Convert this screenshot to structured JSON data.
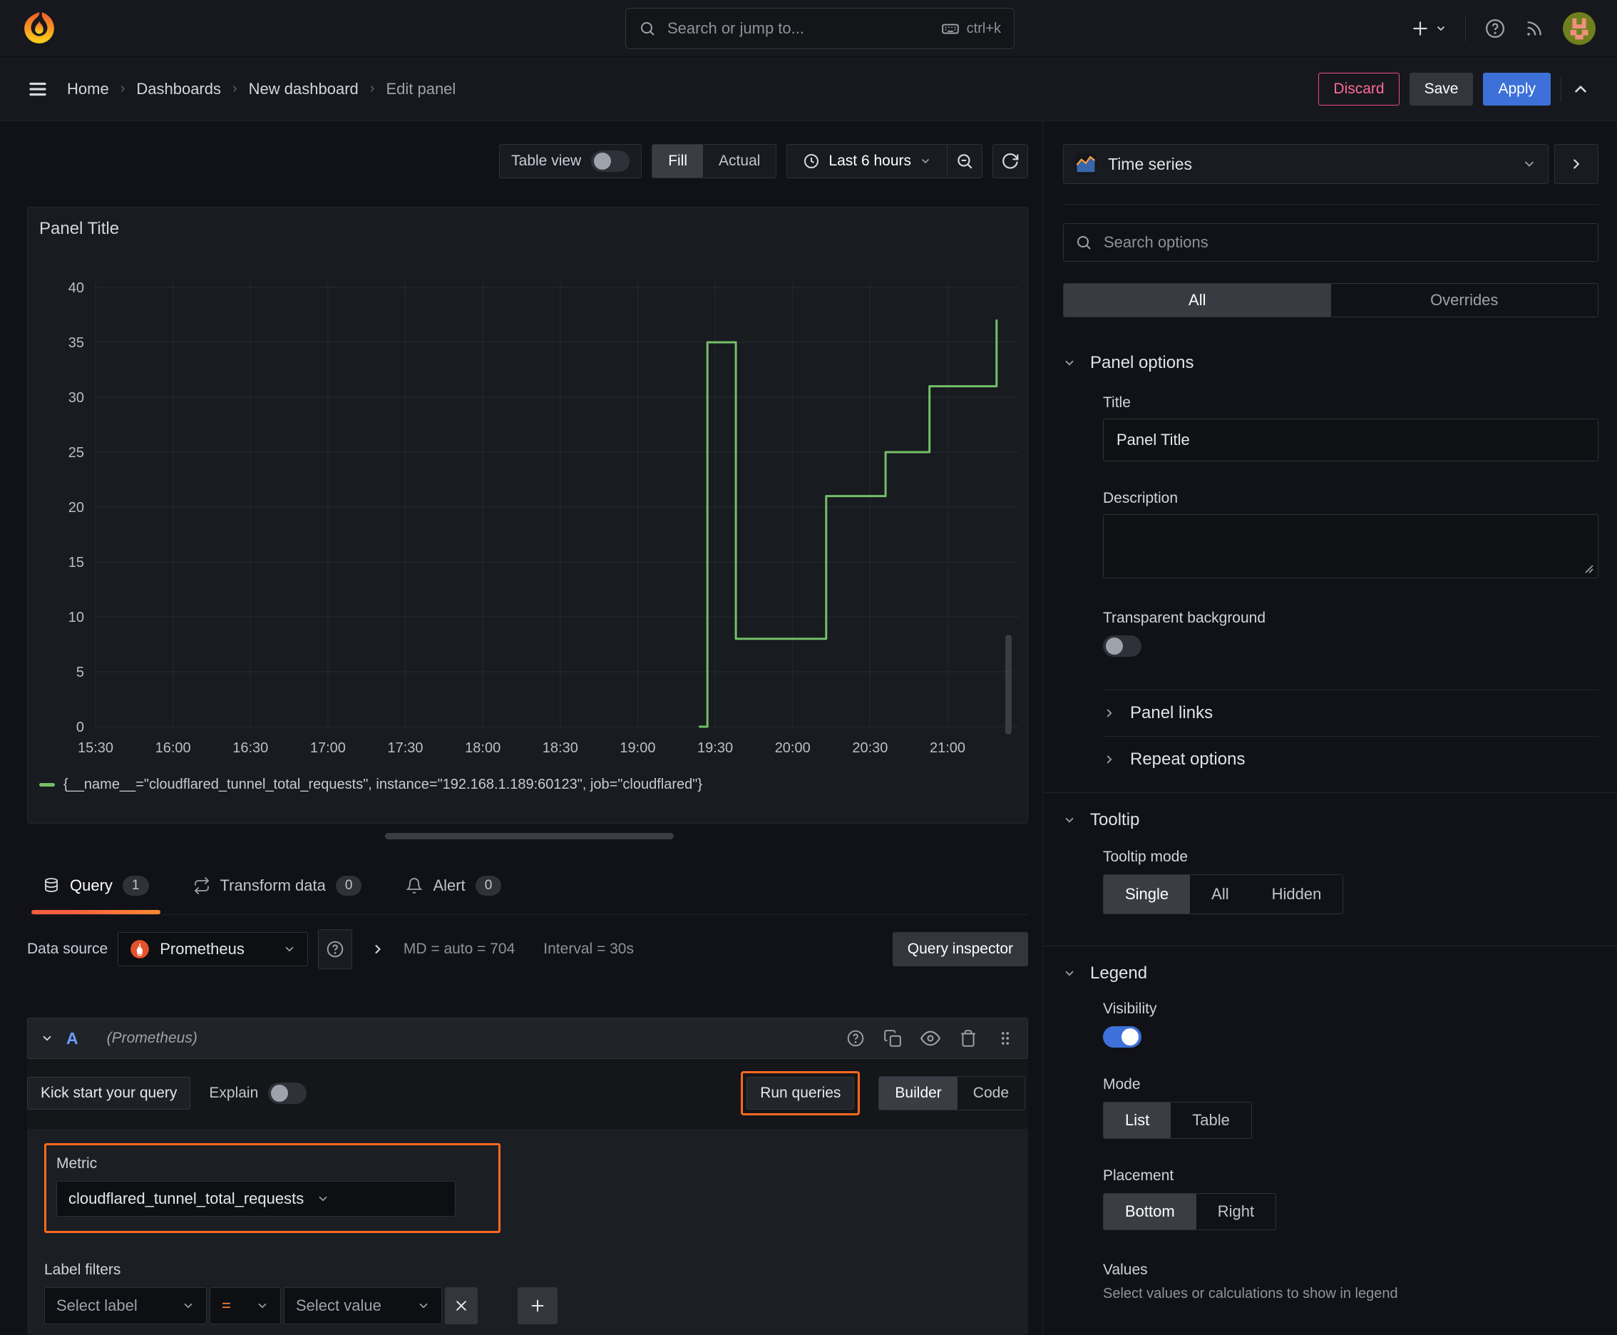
{
  "topbar": {
    "search_placeholder": "Search or jump to...",
    "shortcut": "ctrl+k"
  },
  "breadcrumb": {
    "items": [
      "Home",
      "Dashboards",
      "New dashboard",
      "Edit panel"
    ]
  },
  "actions": {
    "discard": "Discard",
    "save": "Save",
    "apply": "Apply"
  },
  "toolbar": {
    "table_view": "Table view",
    "fill": "Fill",
    "actual": "Actual",
    "time_range": "Last 6 hours"
  },
  "panel": {
    "title": "Panel Title"
  },
  "chart_data": {
    "type": "line",
    "title": "Panel Title",
    "x_axis": {
      "tick_labels": [
        "15:30",
        "16:00",
        "16:30",
        "17:00",
        "17:30",
        "18:00",
        "18:30",
        "19:00",
        "19:30",
        "20:00",
        "20:30",
        "21:00"
      ],
      "tick_minutes": [
        0,
        30,
        60,
        90,
        120,
        150,
        180,
        210,
        240,
        270,
        300,
        330
      ],
      "unit": "minutes after 15:30"
    },
    "y_axis": {
      "ticks": [
        0,
        5,
        10,
        15,
        20,
        25,
        30,
        35,
        40
      ],
      "range": [
        0,
        42
      ]
    },
    "grid": true,
    "legend_position": "bottom",
    "series": [
      {
        "name": "{__name__=\"cloudflared_tunnel_total_requests\", instance=\"192.168.1.189:60123\", job=\"cloudflared\"}",
        "color": "#73bf69",
        "points": [
          [
            234,
            0
          ],
          [
            237,
            0
          ],
          [
            237,
            35
          ],
          [
            248,
            35
          ],
          [
            248,
            8
          ],
          [
            283,
            8
          ],
          [
            283,
            21
          ],
          [
            306,
            21
          ],
          [
            306,
            25
          ],
          [
            323,
            25
          ],
          [
            323,
            31
          ],
          [
            349,
            31
          ],
          [
            349,
            37
          ]
        ]
      }
    ]
  },
  "tabs": {
    "query": "Query",
    "query_count": "1",
    "transform": "Transform data",
    "transform_count": "0",
    "alert": "Alert",
    "alert_count": "0"
  },
  "datasource": {
    "label": "Data source",
    "name": "Prometheus",
    "stats": "MD = auto = 704",
    "interval": "Interval = 30s",
    "inspector": "Query inspector"
  },
  "query": {
    "ref_id": "A",
    "ds_hint": "(Prometheus)",
    "kick_start": "Kick start your query",
    "explain": "Explain",
    "run": "Run queries",
    "builder": "Builder",
    "code": "Code",
    "metric_label": "Metric",
    "metric_value": "cloudflared_tunnel_total_requests",
    "label_filters": "Label filters",
    "select_label": "Select label",
    "operator": "=",
    "select_value": "Select value"
  },
  "sidebar": {
    "viz": "Time series",
    "search_placeholder": "Search options",
    "tab_all": "All",
    "tab_overrides": "Overrides",
    "panel_options": {
      "header": "Panel options",
      "title_label": "Title",
      "title_value": "Panel Title",
      "description_label": "Description",
      "transparent": "Transparent background",
      "links": "Panel links",
      "repeat": "Repeat options"
    },
    "tooltip": {
      "header": "Tooltip",
      "mode_label": "Tooltip mode",
      "single": "Single",
      "all": "All",
      "hidden": "Hidden"
    },
    "legend": {
      "header": "Legend",
      "visibility": "Visibility",
      "mode": "Mode",
      "list": "List",
      "table": "Table",
      "placement": "Placement",
      "bottom": "Bottom",
      "right": "Right",
      "values": "Values",
      "values_hint": "Select values or calculations to show in legend"
    }
  },
  "toggles": {
    "table_view": false,
    "explain": false,
    "transparent_background": false,
    "legend_visibility": true
  },
  "colors": {
    "accent_orange": "#ff681f",
    "series_green": "#73bf69",
    "primary_blue": "#3d71d9",
    "danger_pink": "#eb4d82",
    "tab_underline_from": "#f55f3e",
    "tab_underline_to": "#ff8833"
  }
}
